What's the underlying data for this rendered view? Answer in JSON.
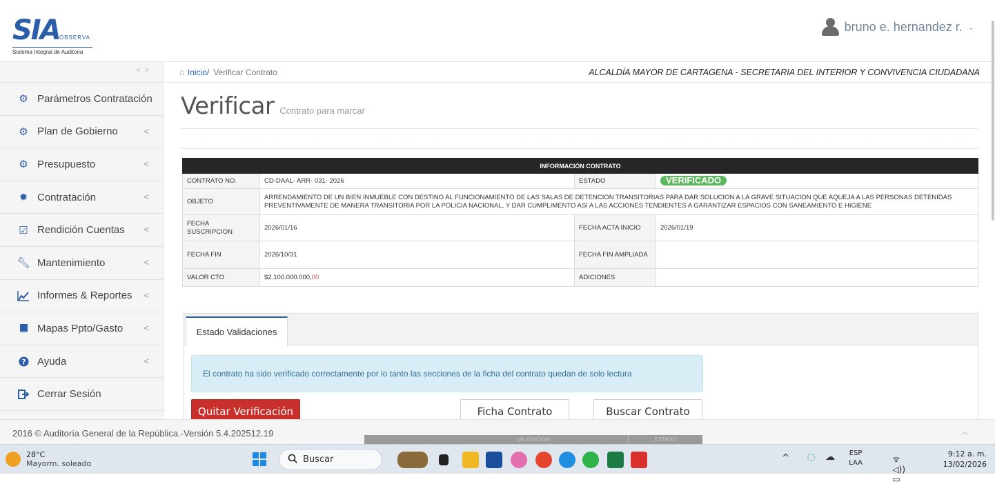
{
  "header": {
    "logo_text": "SIA",
    "logo_observa": "OBSERVA",
    "logo_subtitle": "Sistema Integral de Auditoria",
    "user_name": "bruno e. hernandez r.",
    "user_caret": "⌄"
  },
  "sidebar": {
    "items": [
      {
        "label": "Parámetros Contratación",
        "icon": "gears-icon",
        "has_chevron": false
      },
      {
        "label": "Plan de Gobierno",
        "icon": "gears-icon",
        "has_chevron": true
      },
      {
        "label": "Presupuesto",
        "icon": "gears-icon",
        "has_chevron": true
      },
      {
        "label": "Contratación",
        "icon": "badge-icon",
        "has_chevron": true
      },
      {
        "label": "Rendición Cuentas",
        "icon": "check-square-icon",
        "has_chevron": true
      },
      {
        "label": "Mantenimiento",
        "icon": "wrench-icon",
        "has_chevron": true
      },
      {
        "label": "Informes & Reportes",
        "icon": "line-chart-icon",
        "has_chevron": true
      },
      {
        "label": "Mapas Ppto/Gasto",
        "icon": "book-icon",
        "has_chevron": true
      },
      {
        "label": "Ayuda",
        "icon": "question-circle-icon",
        "has_chevron": true
      },
      {
        "label": "Cerrar Sesión",
        "icon": "sign-out-icon",
        "has_chevron": false
      }
    ],
    "chevron": "<"
  },
  "breadcrumb": {
    "home": "Inicio/",
    "current": "Verificar Contrato",
    "entity": "ALCALDÍA MAYOR DE CARTAGENA - SECRETARIA DEL INTERIOR Y CONVIVENCIA CIUDADANA"
  },
  "page": {
    "title": "Verificar",
    "subtitle": "Contrato para marcar"
  },
  "contract": {
    "header": "INFORMACIÓN CONTRATO",
    "contrato_no_label": "CONTRATO NO.",
    "contrato_no": "CD-DAAL- ARR- 031- 2026",
    "estado_label": "ESTADO",
    "estado": "VERIFICADO",
    "objeto_label": "OBJETO",
    "objeto": "ARRENDAMIENTO DE UN BIEN INMUEBLE CON DESTINO AL FUNCIONAMIENTO DE LAS SALAS DE DETENCION TRANSITORIAS PARA DAR SOLUCION A LA GRAVE SITUACION QUE AQUEJA A LAS PERSONAS DETENIDAS PREVENTIVAMENTE DE MANERA TRANSITORIA POR LA POLICIA NACIONAL, Y DAR CUMPLIMENTO ASI A LAS ACCIONES TENDIENTES A GARANTIZAR ESPACIOS CON SANEAMIENTO E HIGIENE",
    "fecha_suscripcion_label": "FECHA SUSCRIPCION",
    "fecha_suscripcion": "2026/01/16",
    "fecha_acta_inicio_label": "FECHA ACTA INICIO",
    "fecha_acta_inicio": "2026/01/19",
    "fecha_fin_label": "FECHA FIN",
    "fecha_fin": "2026/10/31",
    "fecha_fin_ampliada_label": "FECHA FIN AMPLIADA",
    "fecha_fin_ampliada": "",
    "valor_label": "VALOR CTO",
    "valor_main": "$2.100.000.000,",
    "valor_cents": "00",
    "adiciones_label": "ADICIONES",
    "adiciones": ""
  },
  "validations": {
    "tab_label": "Estado Validaciones",
    "alert": "El contrato ha sido verificado correctamente por lo tanto las secciones de la ficha del contrato quedan de solo lectura",
    "btn_quitar": "Quitar Verificación",
    "btn_ficha": "Ficha Contrato",
    "btn_buscar": "Buscar Contrato",
    "ghost_col1": "VALIDACION",
    "ghost_col2": "ESTADO"
  },
  "footer": {
    "text": "2016 © Auditoría General de la República.-Versión 5.4.202512.19"
  },
  "taskbar": {
    "temp": "28°C",
    "weather": "Mayorm. soleado",
    "search": "Buscar",
    "lang1": "ESP",
    "lang2": "LAA",
    "time": "9:12 a. m.",
    "date": "13/02/2026"
  },
  "colors": {
    "brand_blue": "#2b5da8",
    "danger": "#c9302c",
    "success": "#5cb85c",
    "alert_bg": "#d9edf7"
  }
}
